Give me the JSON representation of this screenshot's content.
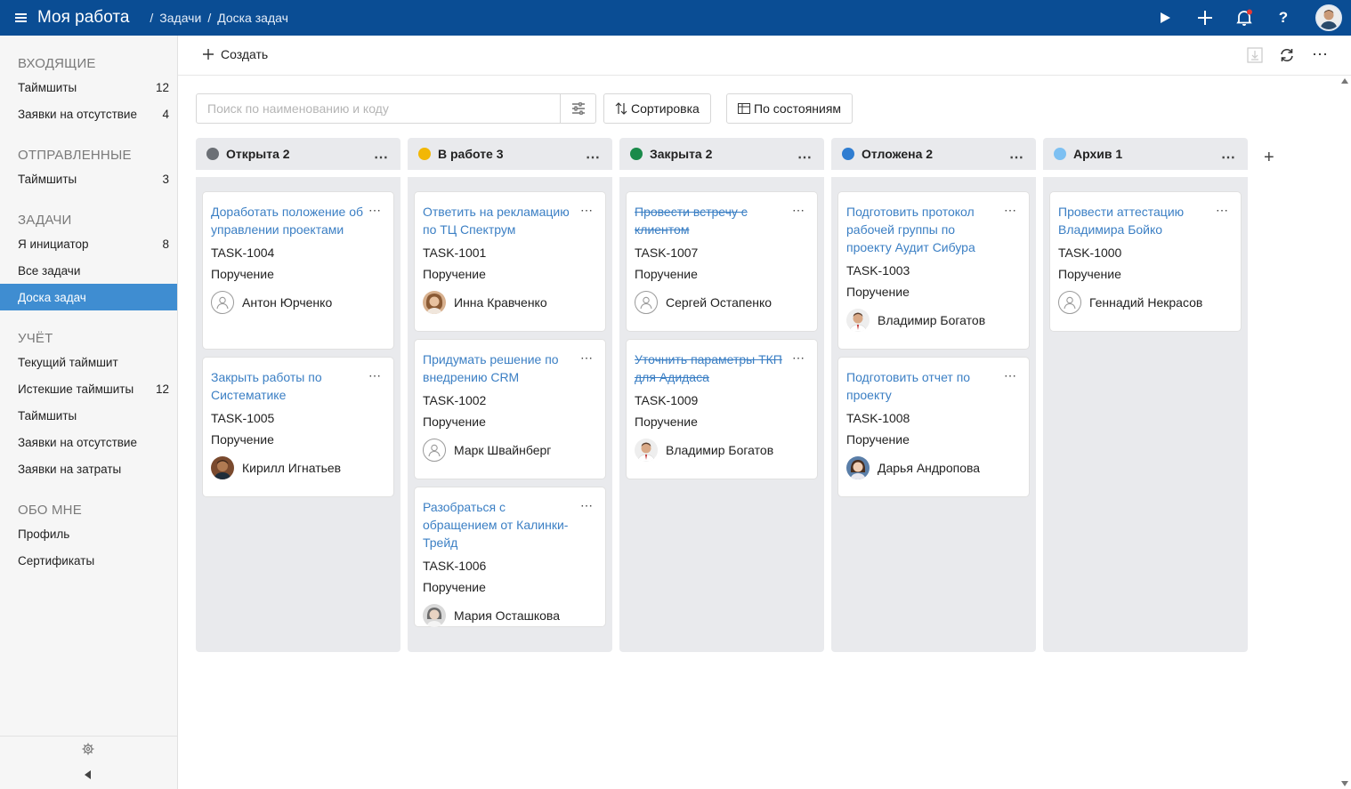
{
  "header": {
    "title": "Моя работа",
    "breadcrumbs": [
      "/",
      "Задачи",
      "/",
      "Доска задач"
    ],
    "bg": "#0a4d94"
  },
  "sidebar": {
    "sections": [
      {
        "title": "ВХОДЯЩИЕ",
        "items": [
          {
            "label": "Таймшиты",
            "count": "12"
          },
          {
            "label": "Заявки на отсутствие",
            "count": "4"
          }
        ]
      },
      {
        "title": "ОТПРАВЛЕННЫЕ",
        "items": [
          {
            "label": "Таймшиты",
            "count": "3"
          }
        ]
      },
      {
        "title": "ЗАДАЧИ",
        "items": [
          {
            "label": "Я инициатор",
            "count": "8"
          },
          {
            "label": "Все задачи",
            "count": ""
          },
          {
            "label": "Доска задач",
            "count": "",
            "active": true
          }
        ]
      },
      {
        "title": "УЧЁТ",
        "items": [
          {
            "label": "Текущий таймшит",
            "count": ""
          },
          {
            "label": "Истекшие таймшиты",
            "count": "12"
          },
          {
            "label": "Таймшиты",
            "count": ""
          },
          {
            "label": "Заявки на отсутствие",
            "count": ""
          },
          {
            "label": "Заявки на затраты",
            "count": ""
          }
        ]
      },
      {
        "title": "ОБО МНЕ",
        "items": [
          {
            "label": "Профиль",
            "count": ""
          },
          {
            "label": "Сертификаты",
            "count": ""
          }
        ]
      }
    ]
  },
  "toolbar": {
    "create_label": "Создать"
  },
  "search": {
    "placeholder": "Поиск по наименованию и коду",
    "value": ""
  },
  "buttons": {
    "sort_label": "Сортировка",
    "group_label": "По состояниям"
  },
  "board": {
    "columns": [
      {
        "title": "Открыта 2",
        "color": "#6b6f75",
        "cards": [
          {
            "title": "Доработать положение об управлении проектами",
            "code": "TASK-1004",
            "type": "Поручение",
            "person": "Антон Юрченко",
            "avatar": "empty",
            "done": false
          },
          {
            "title": "Закрыть работы по Систематике",
            "code": "TASK-1005",
            "type": "Поручение",
            "person": "Кирилл Игнатьев",
            "avatar": "photo",
            "done": false
          }
        ]
      },
      {
        "title": "В работе 3",
        "color": "#f2b705",
        "cards": [
          {
            "title": "Ответить на рекламацию по ТЦ Спектрум",
            "code": "TASK-1001",
            "type": "Поручение",
            "person": "Инна Кравченко",
            "avatar": "photo",
            "done": false
          },
          {
            "title": "Придумать решение по внедрению CRM",
            "code": "TASK-1002",
            "type": "Поручение",
            "person": "Марк Швайнберг",
            "avatar": "empty",
            "done": false
          },
          {
            "title": "Разобраться с обращением от Калинки-Трейд",
            "code": "TASK-1006",
            "type": "Поручение",
            "person": "Мария Осташкова",
            "avatar": "photo",
            "done": false
          }
        ]
      },
      {
        "title": "Закрыта 2",
        "color": "#1a8a4a",
        "cards": [
          {
            "title": "Провести встречу с клиентом",
            "code": "TASK-1007",
            "type": "Поручение",
            "person": "Сергей Остапенко",
            "avatar": "empty",
            "done": true
          },
          {
            "title": "Уточнить параметры ТКП для Адидаса",
            "code": "TASK-1009",
            "type": "Поручение",
            "person": "Владимир Богатов",
            "avatar": "photo",
            "done": true
          }
        ]
      },
      {
        "title": "Отложена 2",
        "color": "#2f7dd1",
        "cards": [
          {
            "title": "Подготовить протокол рабочей группы по проекту Аудит Сибура",
            "code": "TASK-1003",
            "type": "Поручение",
            "person": "Владимир Богатов",
            "avatar": "photo",
            "done": false
          },
          {
            "title": "Подготовить отчет по проекту",
            "code": "TASK-1008",
            "type": "Поручение",
            "person": "Дарья Андропова",
            "avatar": "photo",
            "done": false
          }
        ]
      },
      {
        "title": "Архив 1",
        "color": "#7dc0f2",
        "cards": [
          {
            "title": "Провести аттестацию Владимира Бойко",
            "code": "TASK-1000",
            "type": "Поручение",
            "person": "Геннадий Некрасов",
            "avatar": "empty",
            "done": false
          }
        ]
      }
    ]
  },
  "icons": {
    "more": "⋯",
    "add": "+"
  }
}
